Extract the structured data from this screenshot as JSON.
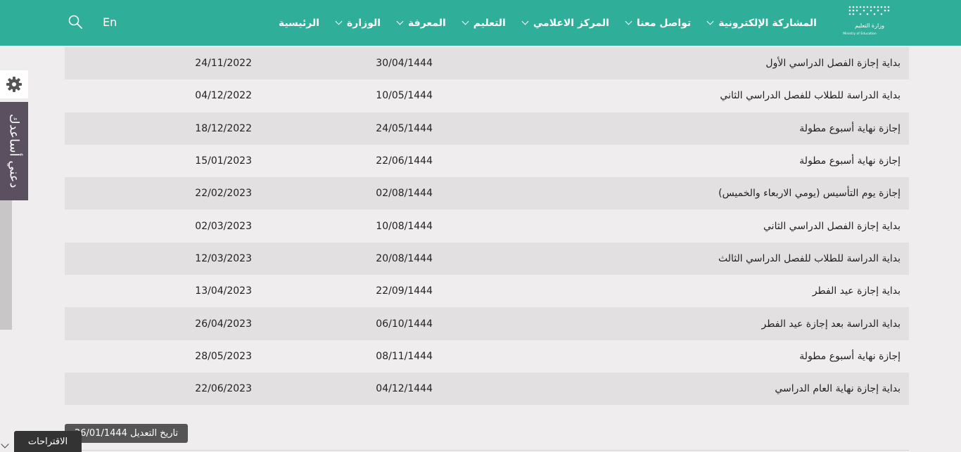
{
  "header": {
    "logo_title": "وزارة التعليم",
    "logo_subtitle": "Ministry of Education",
    "nav": [
      {
        "label": "الرئيسية",
        "dropdown": false
      },
      {
        "label": "الوزارة",
        "dropdown": true
      },
      {
        "label": "المعرفة",
        "dropdown": true
      },
      {
        "label": "التعليم",
        "dropdown": true
      },
      {
        "label": "المركز الاعلامي",
        "dropdown": true
      },
      {
        "label": "تواصل معنا",
        "dropdown": true
      },
      {
        "label": "المشاركة الإلكترونية",
        "dropdown": true
      }
    ],
    "lang_label": "En",
    "search_icon": "search-icon"
  },
  "table": {
    "rows": [
      {
        "event": "بداية إجازة الفصل الدراسي الأول",
        "hijri": "30/04/1444",
        "gregorian": "24/11/2022"
      },
      {
        "event": "بداية الدراسة للطلاب للفصل الدراسي الثاني",
        "hijri": "10/05/1444",
        "gregorian": "04/12/2022"
      },
      {
        "event": "إجازة نهاية أسبوع مطولة",
        "hijri": "24/05/1444",
        "gregorian": "18/12/2022"
      },
      {
        "event": "إجازة نهاية أسبوع مطولة",
        "hijri": "22/06/1444",
        "gregorian": "15/01/2023"
      },
      {
        "event": "إجازة يوم التأسيس (يومي الاربعاء والخميس)",
        "hijri": "02/08/1444",
        "gregorian": "22/02/2023"
      },
      {
        "event": "بداية إجازة الفصل الدراسي الثاني",
        "hijri": "10/08/1444",
        "gregorian": "02/03/2023"
      },
      {
        "event": "بداية الدراسة للطلاب للفصل الدراسي الثالث",
        "hijri": "20/08/1444",
        "gregorian": "12/03/2023"
      },
      {
        "event": "بداية إجازة عيد الفطر",
        "hijri": "22/09/1444",
        "gregorian": "13/04/2023"
      },
      {
        "event": "بداية الدراسة بعد إجازة عيد الفطر",
        "hijri": "06/10/1444",
        "gregorian": "26/04/2023"
      },
      {
        "event": "إجازة نهاية أسبوع مطولة",
        "hijri": "08/11/1444",
        "gregorian": "28/05/2023"
      },
      {
        "event": "بداية إجازة نهاية العام الدراسي",
        "hijri": "04/12/1444",
        "gregorian": "22/06/2023"
      }
    ]
  },
  "modified": {
    "label": "تاريخ التعديل 26/01/1444"
  },
  "side": {
    "gear_icon": "gear-icon",
    "help_label": "دعني أساعدك",
    "suggestions_label": "الاقتراحات"
  },
  "colors": {
    "header_bg": "#2fae9a",
    "row_odd": "#e2e0e1",
    "row_even": "#efedee",
    "help_tab_bg": "#5a5060"
  }
}
